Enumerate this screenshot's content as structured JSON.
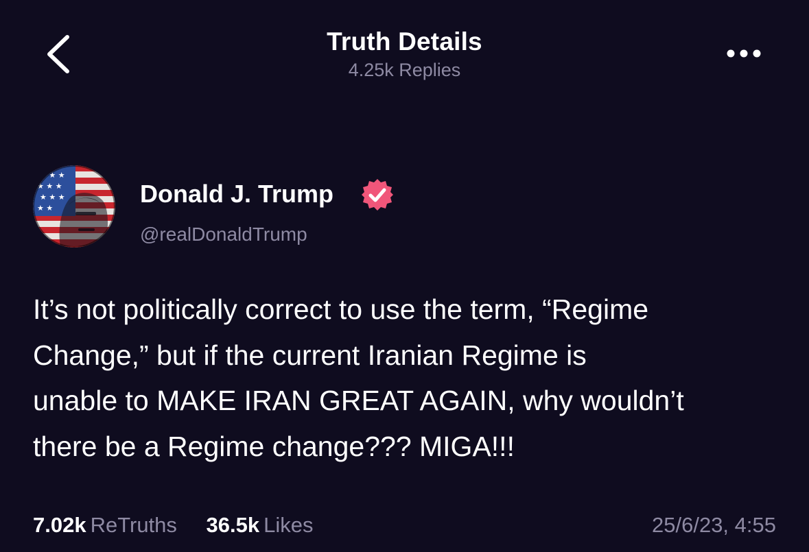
{
  "header": {
    "title": "Truth Details",
    "replies": "4.25k Replies"
  },
  "post": {
    "author_name": "Donald J. Trump",
    "author_handle": "@realDonaldTrump",
    "body": "It’s not politically correct to use the term, “Regime\nChange,” but if the current Iranian Regime is\nunable to MAKE IRAN GREAT AGAIN, why wouldn’t\nthere be a Regime change??? MIGA!!!",
    "stats": {
      "retruths_value": "7.02k",
      "retruths_label": "ReTruths",
      "likes_value": "36.5k",
      "likes_label": "Likes"
    },
    "timestamp": "25/6/23, 4:55"
  },
  "icons": {
    "back": "chevron-left-icon",
    "more": "more-horizontal-icon",
    "verified": "verified-badge-icon"
  },
  "colors": {
    "background": "#0f0c1f",
    "muted_text": "#8e8aa3",
    "verified": "#f0567a"
  }
}
